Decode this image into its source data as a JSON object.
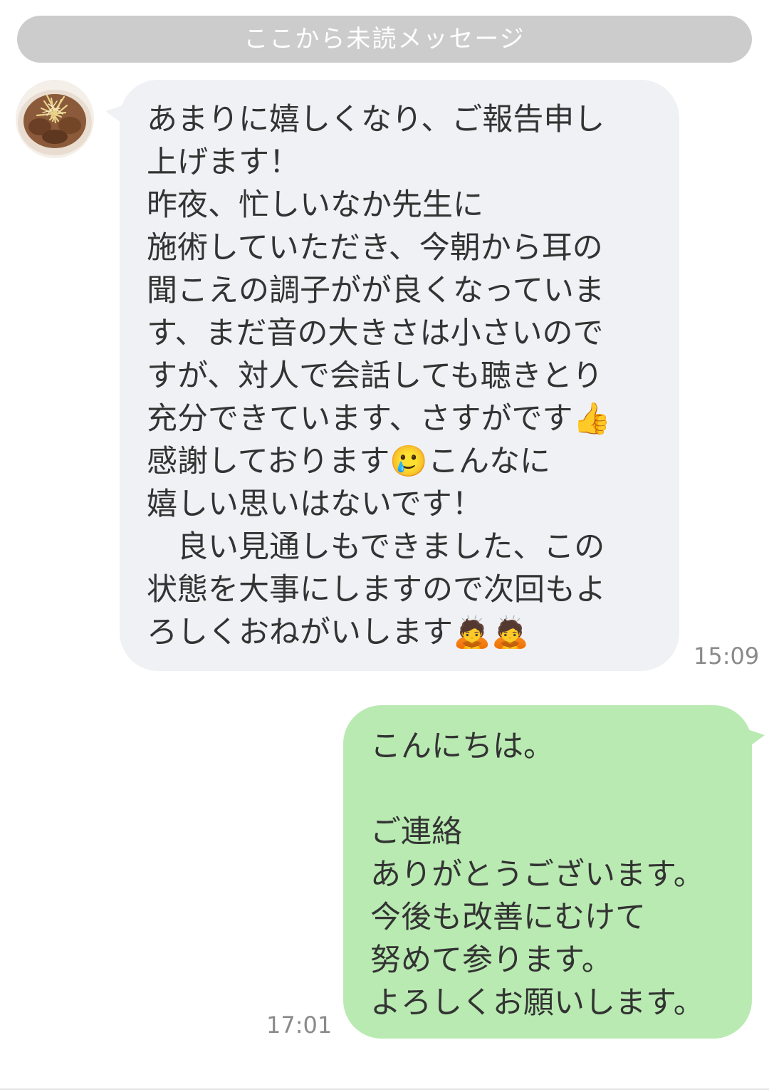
{
  "banner": {
    "label": "ここから未読メッセージ"
  },
  "messages": [
    {
      "direction": "incoming",
      "avatar_icon": "food-avatar",
      "text": "あまりに嬉しくなり、ご報告申し\n上げます！\n昨夜、忙しいなか先生に\n施術していただき、今朝から耳の\n聞こえの調子がが良くなっていま\nす、まだ音の大きさは小さいので\nすが、対人で会話しても聴きとり\n充分できています、さすがです👍\n感謝しております🥲こんなに\n嬉しい思いはないです！\n　良い見通しもできました、この\n状態を大事にしますので次回もよ\nろしくおねがいします🙇🙇",
      "time": "15:09"
    },
    {
      "direction": "outgoing",
      "text": "こんにちは。\n\nご連絡\nありがとうございます。\n今後も改善にむけて\n努めて参ります。\nよろしくお願いします。",
      "time": "17:01"
    }
  ],
  "colors": {
    "banner_bg": "#cccccc",
    "incoming_bubble": "#f0f1f4",
    "outgoing_bubble": "#b9eab2",
    "timestamp": "#8a8a8a"
  }
}
